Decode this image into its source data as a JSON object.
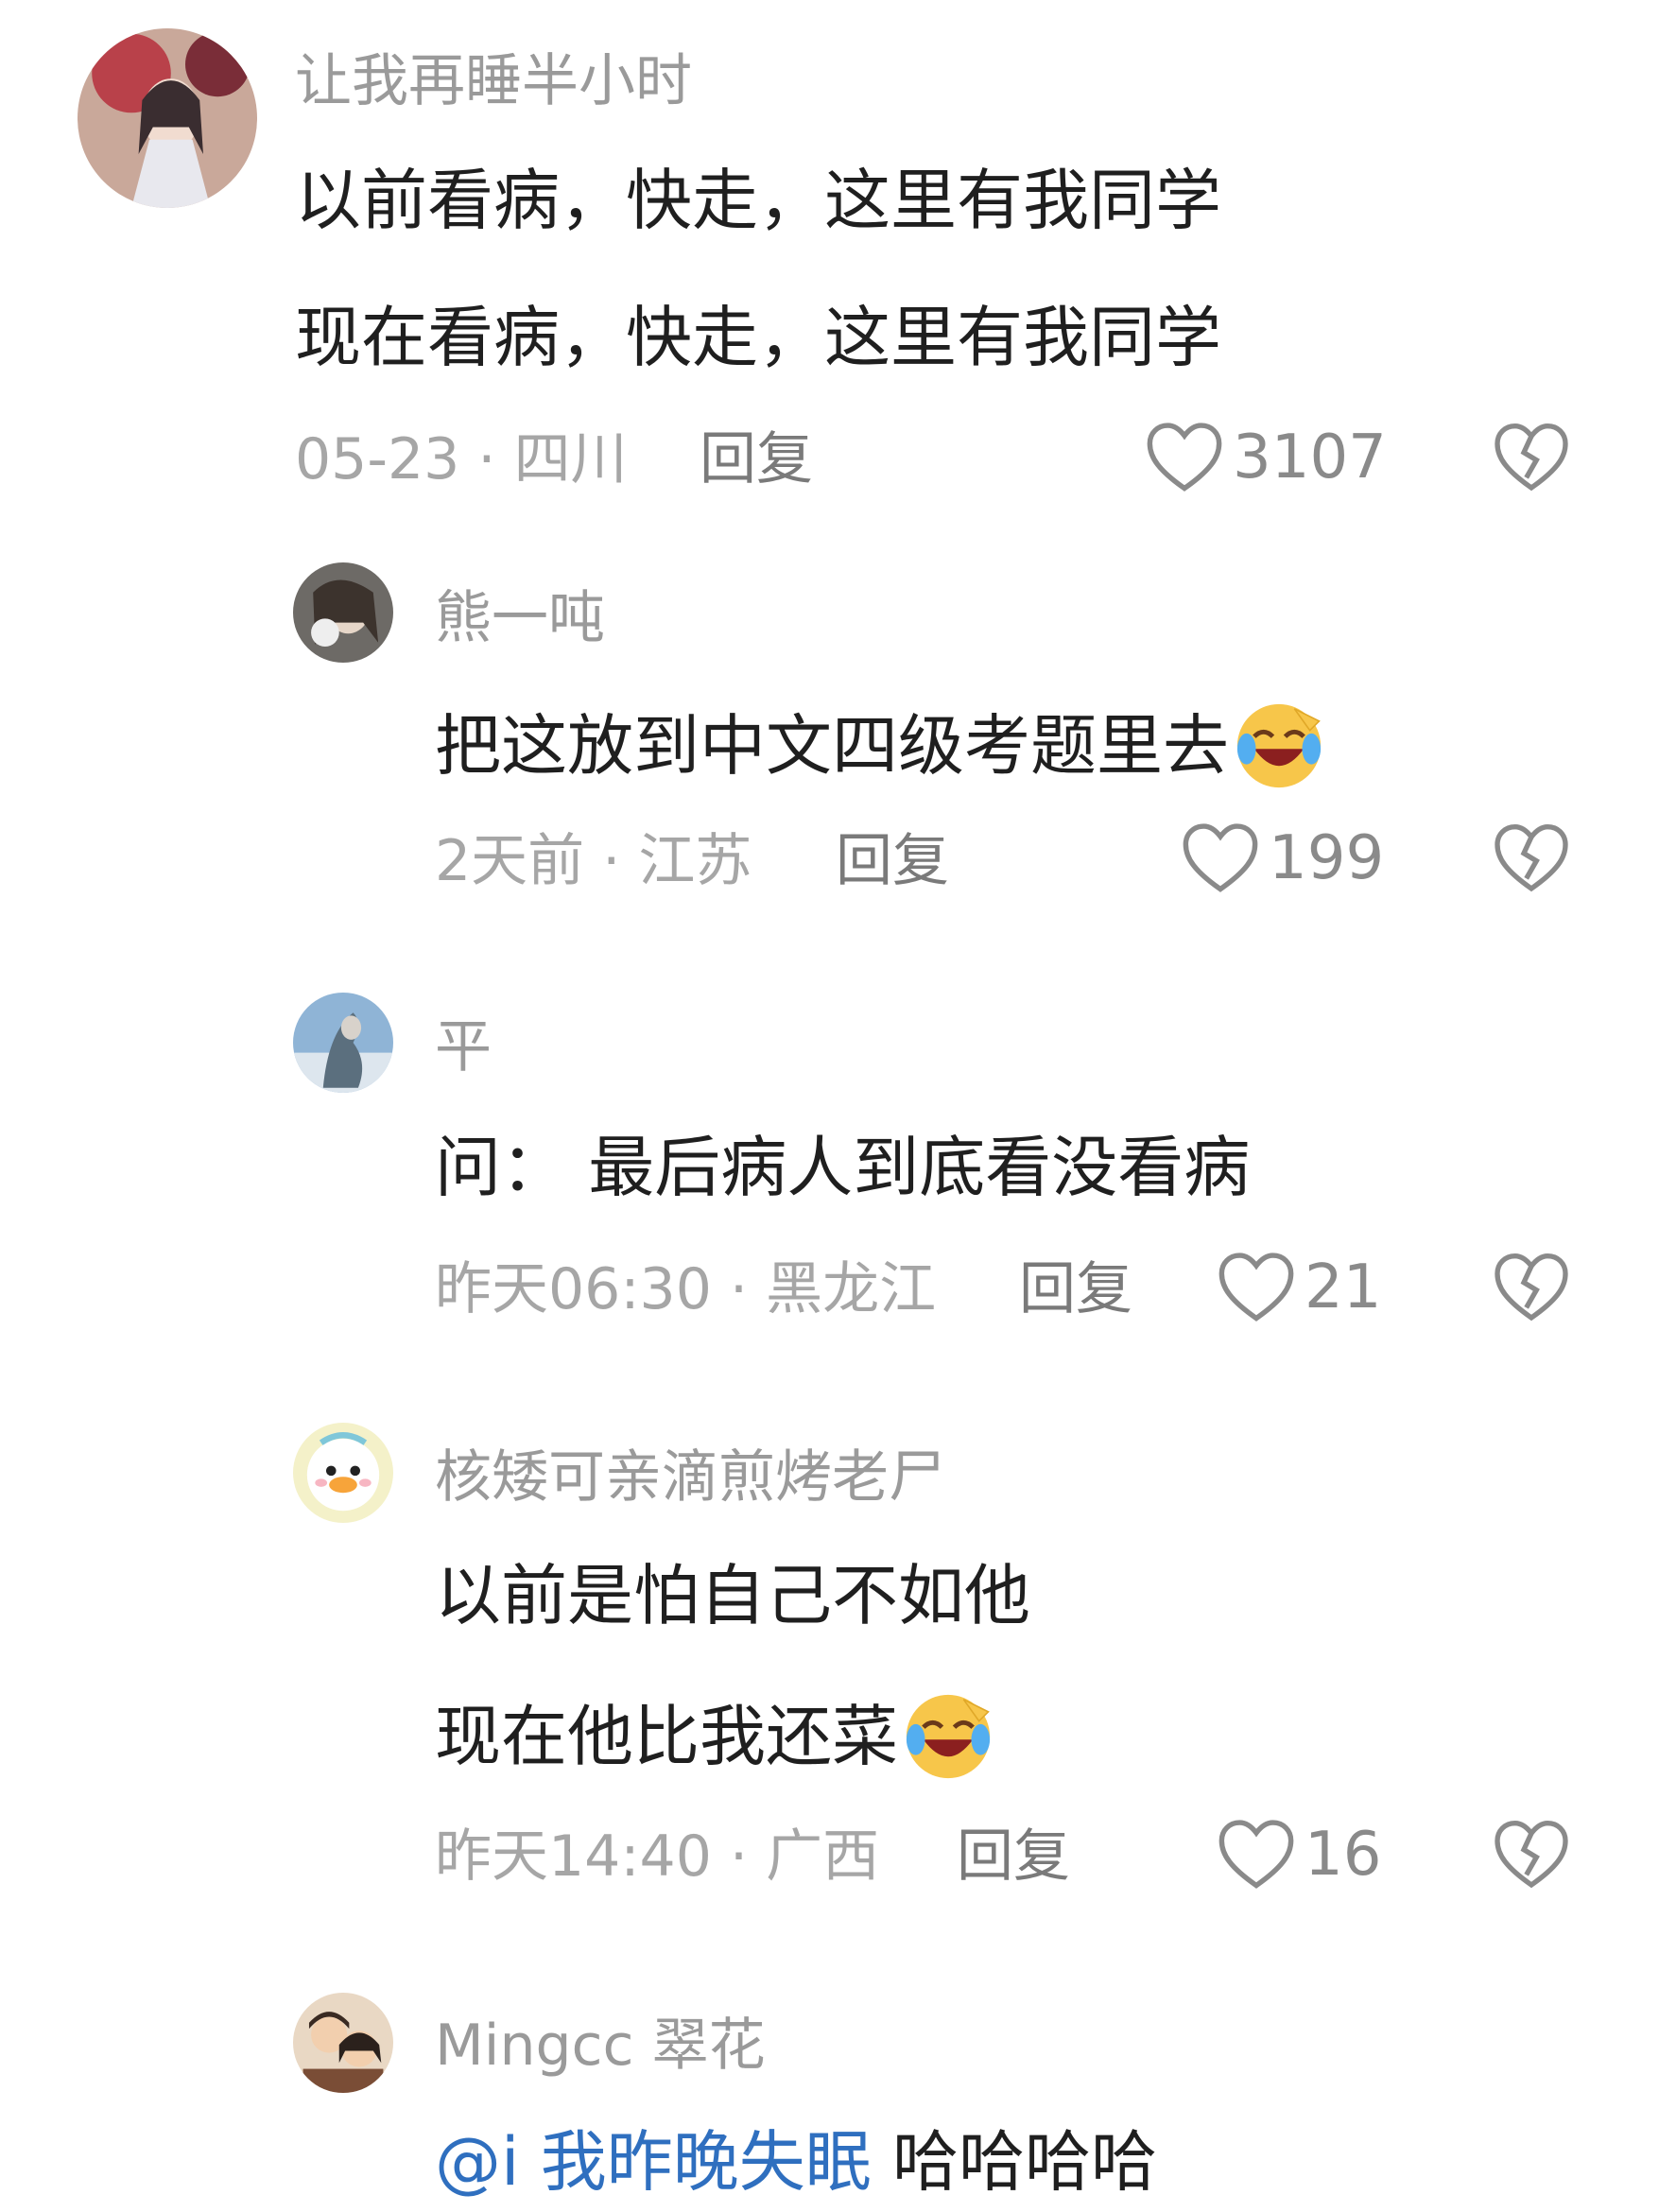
{
  "comments": [
    {
      "username": "让我再睡半小时",
      "lines": [
        "以前看病，快走，这里有我同学",
        "现在看病，快走，这里有我同学"
      ],
      "time": "05-23 · 四川",
      "reply": "回复",
      "likes": "3107"
    },
    {
      "username": "熊一吨",
      "lines": [
        "把这放到中文四级考题里去"
      ],
      "time": "2天前 · 江苏",
      "reply": "回复",
      "likes": "199"
    },
    {
      "username": "平",
      "lines": [
        "问：  最后病人到底看没看病"
      ],
      "time": "昨天06:30 · 黑龙江",
      "reply": "回复",
      "likes": "21"
    },
    {
      "username": "核矮可亲滴煎烤老尸",
      "lines": [
        "以前是怕自己不如他",
        "现在他比我还菜"
      ],
      "time": "昨天14:40 · 广西",
      "reply": "回复",
      "likes": "16"
    },
    {
      "username": "Mingcc 翠花",
      "mention": "@i 我昨晚失眠",
      "text": " 哈哈哈哈"
    }
  ],
  "icons": {
    "like": "heart-outline-icon",
    "dislike": "broken-heart-icon",
    "emoji": "laughing-crying-emoji"
  }
}
